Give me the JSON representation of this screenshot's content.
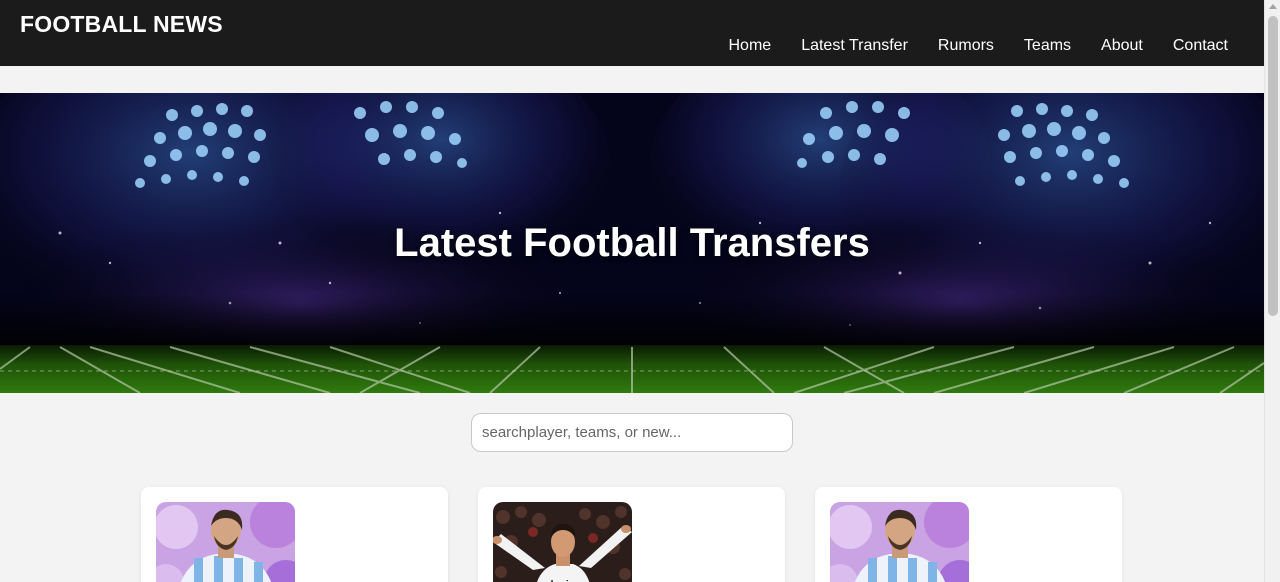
{
  "header": {
    "logo": "FOOTBALL NEWS",
    "nav": [
      "Home",
      "Latest Transfer",
      "Rumors",
      "Teams",
      "About",
      "Contact"
    ]
  },
  "hero": {
    "title": "Latest Football Transfers"
  },
  "search": {
    "placeholder": "searchplayer, teams, or new..."
  },
  "cards": [
    {
      "image": "player-argentina-jersey"
    },
    {
      "image": "player-real-madrid-jersey"
    },
    {
      "image": "player-argentina-jersey"
    }
  ],
  "colors": {
    "header_bg": "#1b1b1b",
    "page_bg": "#f3f3f3",
    "hero_dark": "#05051a",
    "field_green": "#2e6b0c"
  }
}
